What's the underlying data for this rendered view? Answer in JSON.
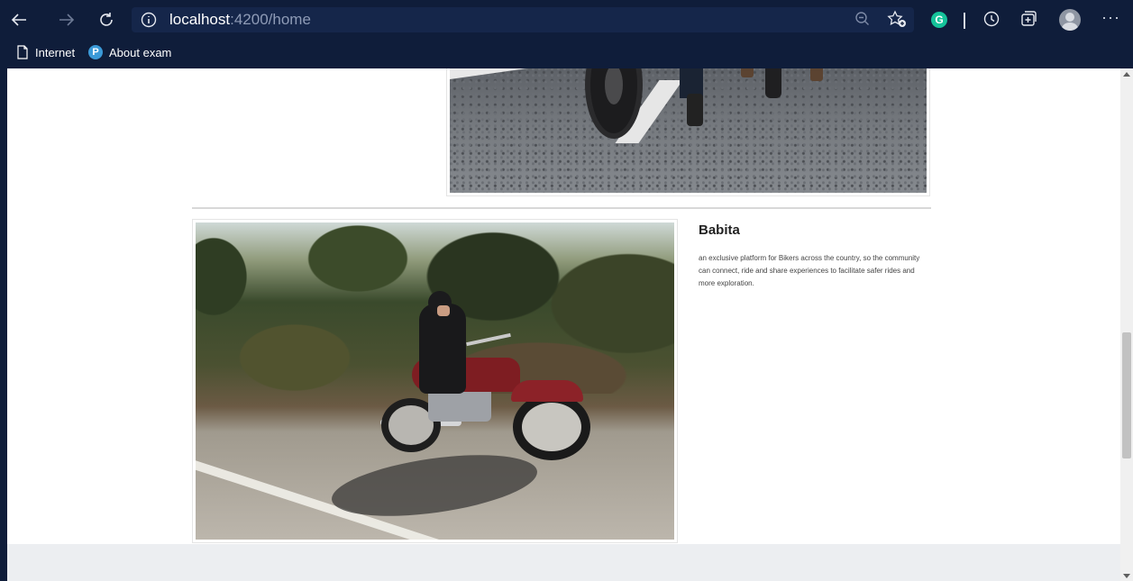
{
  "browser": {
    "url_host": "localhost",
    "url_rest": ":4200/home",
    "extension_badge": "G",
    "more_label": "···"
  },
  "favorites": [
    {
      "label": "Internet"
    },
    {
      "label": "About exam",
      "badge": "P"
    }
  ],
  "page": {
    "card": {
      "title": "Babita",
      "description": "an exclusive platform for Bikers across the country, so the community can connect, ride and share experiences to facilitate safer rides and more exploration."
    }
  },
  "colors": {
    "chrome": "#0f1d3a",
    "address_bar": "#15264a",
    "footer": "#eceef1",
    "grammarly": "#15c39a"
  },
  "icons": [
    "back-icon",
    "forward-icon",
    "refresh-icon",
    "info-icon",
    "zoom-out-icon",
    "add-favorite-icon",
    "history-icon",
    "collections-icon",
    "page-icon"
  ]
}
